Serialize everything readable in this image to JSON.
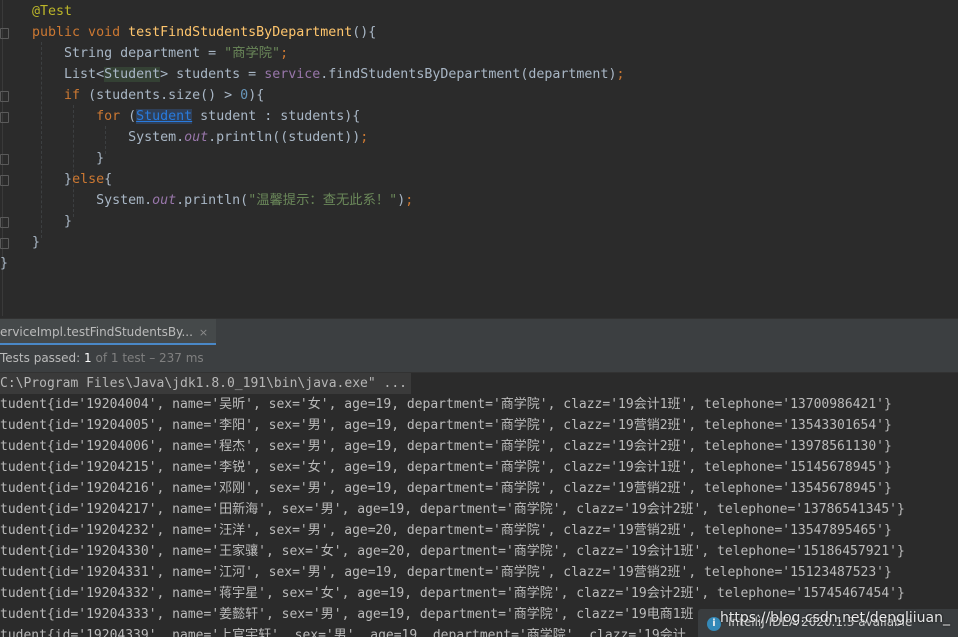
{
  "editor": {
    "code_lines": [
      [
        {
          "t": "    @Test",
          "c": "ann"
        }
      ],
      [
        {
          "t": "    public void ",
          "c": "kw"
        },
        {
          "t": "testFindStudentsByDepartment",
          "c": "fn"
        },
        {
          "t": "(){",
          "c": ""
        }
      ],
      [
        {
          "t": "        String department = ",
          "c": ""
        },
        {
          "t": "\"商学院\"",
          "c": "str"
        },
        {
          "t": ";",
          "c": "punc"
        }
      ],
      [
        {
          "t": "        List<",
          "c": ""
        },
        {
          "t": "Student",
          "c": "type-hl"
        },
        {
          "t": "> students = ",
          "c": ""
        },
        {
          "t": "service",
          "c": "fld"
        },
        {
          "t": ".findStudentsByDepartment(department)",
          "c": ""
        },
        {
          "t": ";",
          "c": "punc"
        }
      ],
      [
        {
          "t": "        ",
          "c": ""
        },
        {
          "t": "if",
          "c": "kw"
        },
        {
          "t": " (students.size() > ",
          "c": ""
        },
        {
          "t": "0",
          "c": "num"
        },
        {
          "t": "){",
          "c": ""
        }
      ],
      [
        {
          "t": "            ",
          "c": ""
        },
        {
          "t": "for",
          "c": "kw"
        },
        {
          "t": " (",
          "c": ""
        },
        {
          "t": "Student",
          "c": "type-link"
        },
        {
          "t": " student : students){",
          "c": ""
        }
      ],
      [
        {
          "t": "                System.",
          "c": ""
        },
        {
          "t": "out",
          "c": "fld-it"
        },
        {
          "t": ".println((student))",
          "c": ""
        },
        {
          "t": ";",
          "c": "punc"
        }
      ],
      [
        {
          "t": "            }",
          "c": ""
        }
      ],
      [
        {
          "t": "        }",
          "c": ""
        },
        {
          "t": "else",
          "c": "kw"
        },
        {
          "t": "{",
          "c": ""
        }
      ],
      [
        {
          "t": "            System.",
          "c": ""
        },
        {
          "t": "out",
          "c": "fld-it"
        },
        {
          "t": ".println(",
          "c": ""
        },
        {
          "t": "\"温馨提示：查无此系！\"",
          "c": "str"
        },
        {
          "t": ")",
          "c": ""
        },
        {
          "t": ";",
          "c": "punc"
        }
      ],
      [
        {
          "t": "        }",
          "c": ""
        }
      ],
      [
        {
          "t": "    }",
          "c": ""
        }
      ],
      [
        {
          "t": "}",
          "c": ""
        }
      ]
    ]
  },
  "run_panel": {
    "tab_label": "erviceImpl.testFindStudentsBy...",
    "tab_close": "×",
    "status_prefix": "Tests passed: ",
    "status_passed": "1",
    "status_of": " of 1 test",
    "status_sep": " – ",
    "status_time": "237 ms",
    "command_line": "C:\\Program Files\\Java\\jdk1.8.0_191\\bin\\java.exe\" ...",
    "output_lines": [
      "tudent{id='19204004', name='吴昕', sex='女', age=19, department='商学院', clazz='19会计1班', telephone='13700986421'}",
      "tudent{id='19204005', name='李阳', sex='男', age=19, department='商学院', clazz='19营销2班', telephone='13543301654'}",
      "tudent{id='19204006', name='程杰', sex='男', age=19, department='商学院', clazz='19会计2班', telephone='13978561130'}",
      "tudent{id='19204215', name='李锐', sex='女', age=19, department='商学院', clazz='19会计1班', telephone='15145678945'}",
      "tudent{id='19204216', name='邓刚', sex='男', age=19, department='商学院', clazz='19营销2班', telephone='13545678945'}",
      "tudent{id='19204217', name='田新海', sex='男', age=19, department='商学院', clazz='19会计2班', telephone='13786541345'}",
      "tudent{id='19204232', name='汪洋', sex='男', age=20, department='商学院', clazz='19营销2班', telephone='13547895465'}",
      "tudent{id='19204330', name='王家骧', sex='女', age=20, department='商学院', clazz='19会计1班', telephone='15186457921'}",
      "tudent{id='19204331', name='江河', sex='男', age=19, department='商学院', clazz='19营销2班', telephone='15123487523'}",
      "tudent{id='19204332', name='蒋宇星', sex='女', age=19, department='商学院', clazz='19会计2班', telephone='15745467454'}",
      "tudent{id='19204333', name='姜懿轩', sex='男', age=19, department='商学院', clazz='19电商1班",
      "tudent{id='19204339', name='上官宇轩', sex='男', age=19, department='商学院', clazz='19会计"
    ]
  },
  "notification": {
    "icon": "i",
    "text": "IntelliJ IDEA 2020.1.3 available"
  },
  "watermark": "https://blog.csdn.net/dengliiuan_"
}
